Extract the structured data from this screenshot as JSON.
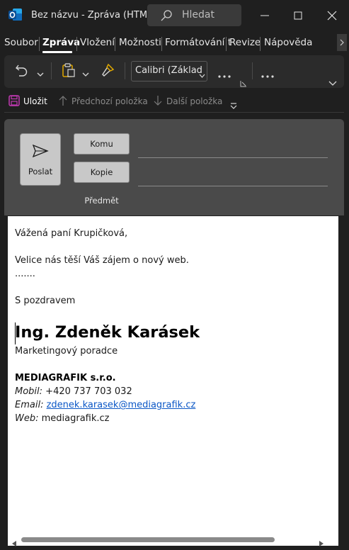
{
  "window": {
    "title": "Bez názvu  -  Zpráva (HTML)"
  },
  "search": {
    "placeholder": "Hledat"
  },
  "tabs": [
    {
      "label": "Soubor"
    },
    {
      "label": "Zpráva"
    },
    {
      "label": "Vložení"
    },
    {
      "label": "Možnosti"
    },
    {
      "label": "Formátování t"
    },
    {
      "label": "Revize"
    },
    {
      "label": "Nápověda"
    }
  ],
  "active_tab": "Zpráva",
  "ribbon": {
    "font_name": "Calibri (Základ"
  },
  "quick_access": {
    "save": "Uložit",
    "prev": "Předchozí položka",
    "next": "Další položka"
  },
  "compose": {
    "send": "Poslat",
    "to": "Komu",
    "cc": "Kopie",
    "subject": "Předmět"
  },
  "body": {
    "greeting": "Vážená paní Krupičková,",
    "line1": "Velice nás těší Váš zájem o nový web.",
    "line2": ".......",
    "closing": "S pozdravem",
    "sig_name": "Ing. Zdeněk Karásek",
    "sig_title": "Marketingový poradce",
    "company": "MEDIAGRAFIK s.r.o.",
    "mobile_label": "Mobil:",
    "mobile": "+420 737 703 032",
    "email_label": "Email:",
    "email": "zdenek.karasek@mediagrafik.cz",
    "web_label": "Web:",
    "web": "mediagrafik.cz"
  },
  "colors": {
    "accent_outlook": "#0f6cbd",
    "link": "#0b57c6",
    "save_icon": "#c239b3"
  }
}
